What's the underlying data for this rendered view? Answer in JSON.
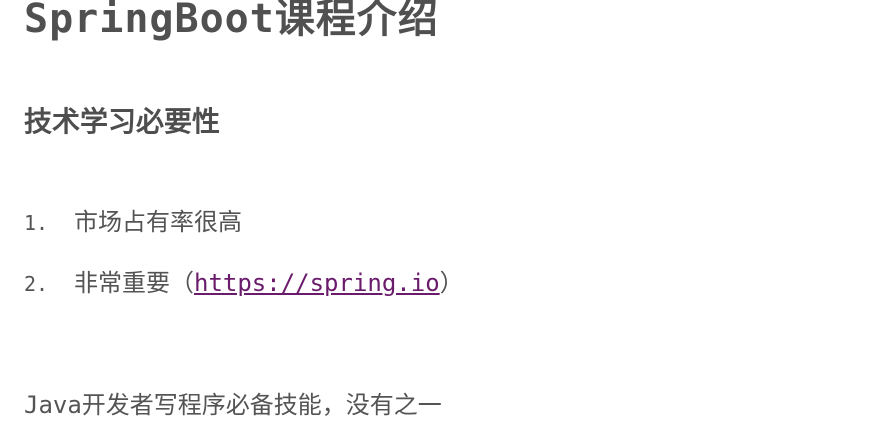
{
  "title": {
    "latin": "SpringBoot",
    "cjk": "课程介绍"
  },
  "section_heading": "技术学习必要性",
  "list": [
    {
      "number": "1.",
      "text": "市场占有率很高"
    },
    {
      "number": "2.",
      "text": "非常重要（",
      "link": "https://spring.io",
      "suffix": "）"
    }
  ],
  "paragraph": {
    "latin": "Java",
    "cjk": "开发者写程序必备技能，没有之一"
  },
  "colors": {
    "text": "#545454",
    "link": "#6b1b6b"
  }
}
